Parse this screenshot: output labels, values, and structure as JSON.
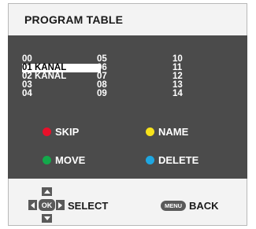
{
  "title": "PROGRAM TABLE",
  "columns": [
    [
      "00",
      "01 KANAL",
      "02 KANAL",
      "03",
      "04"
    ],
    [
      "05",
      "06",
      "07",
      "08",
      "09"
    ],
    [
      "10",
      "11",
      "12",
      "13",
      "14"
    ]
  ],
  "selected": {
    "column": 0,
    "row": 1
  },
  "buttons": {
    "skip": {
      "label": "SKIP",
      "color": "#e8102a"
    },
    "name": {
      "label": "NAME",
      "color": "#f7e21b"
    },
    "move": {
      "label": "MOVE",
      "color": "#13a94b"
    },
    "delete": {
      "label": "DELETE",
      "color": "#1fa7e1"
    }
  },
  "footer": {
    "ok_key": "OK",
    "select_label": "SELECT",
    "menu_key": "MENU",
    "back_label": "BACK"
  }
}
